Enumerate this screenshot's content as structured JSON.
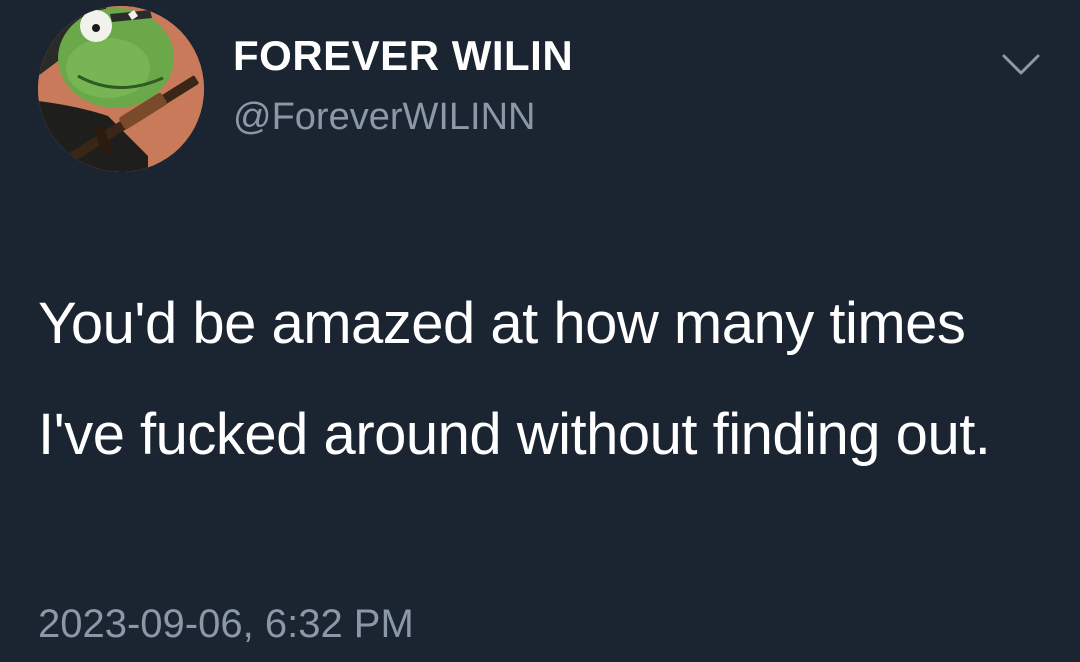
{
  "tweet": {
    "display_name": "FOREVER WILIN",
    "handle": "@ForeverWILINN",
    "text": "You'd be amazed at how many times I've fucked around without finding out.",
    "timestamp": "2023-09-06, 6:32 PM",
    "avatar_icon": "kermit-with-rifle-avatar",
    "menu_icon": "chevron-down-icon"
  },
  "colors": {
    "background": "#1b2431",
    "primary_text": "#ffffff",
    "secondary_text": "#8b98a6"
  }
}
